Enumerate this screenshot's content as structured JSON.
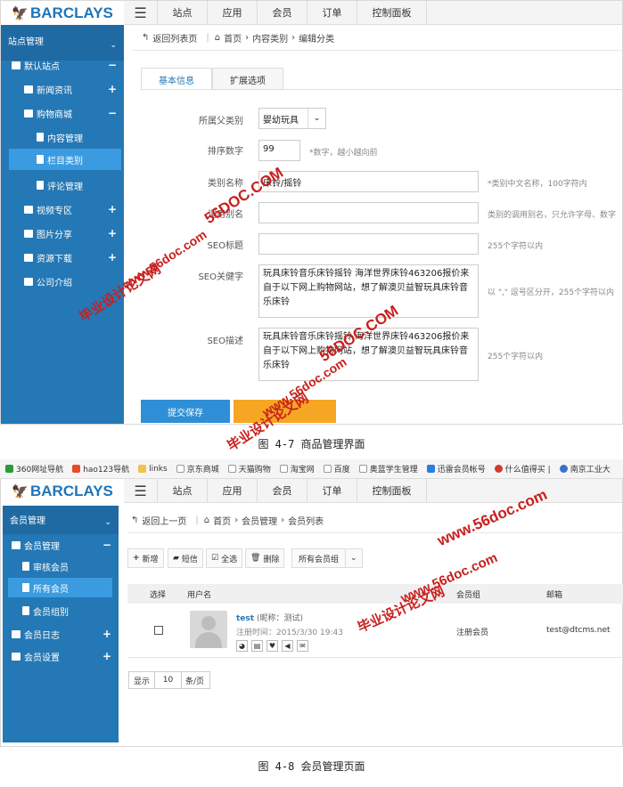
{
  "screen1": {
    "brand": "BARCLAYS",
    "top_tabs": [
      "站点",
      "应用",
      "会员",
      "订单",
      "控制面板"
    ],
    "sidebar": {
      "header": "站点管理",
      "items": [
        {
          "label": "默认站点",
          "toggle": "−"
        },
        {
          "label": "新闻资讯",
          "toggle": "+"
        },
        {
          "label": "购物商城",
          "toggle": "−"
        },
        {
          "label": "内容管理",
          "toggle": ""
        },
        {
          "label": "栏目类别",
          "toggle": ""
        },
        {
          "label": "评论管理",
          "toggle": ""
        },
        {
          "label": "视频专区",
          "toggle": "+"
        },
        {
          "label": "图片分享",
          "toggle": "+"
        },
        {
          "label": "资源下载",
          "toggle": "+"
        },
        {
          "label": "公司介绍",
          "toggle": ""
        }
      ]
    },
    "breadcrumb": {
      "back": "返回列表页",
      "home": "首页",
      "c1": "内容类别",
      "c2": "编辑分类"
    },
    "tabs": [
      "基本信息",
      "扩展选项"
    ],
    "form": {
      "parent_label": "所属父类别",
      "parent_value": "婴幼玩具",
      "sort_label": "排序数字",
      "sort_value": "99",
      "sort_hint": "*数字，越小越向前",
      "name_label": "类别名称",
      "name_value": "床铃/摇铃",
      "name_hint": "*类别中文名称，100字符内",
      "alias_label": "调用别名",
      "alias_value": "",
      "alias_hint": "类别的调用别名，只允许字母、数字",
      "seo_title_label": "SEO标题",
      "seo_title_value": "",
      "seo_title_hint": "255个字符以内",
      "seo_kw_label": "SEO关健字",
      "seo_kw_value": "玩具床铃音乐床铃摇铃 海洋世界床铃463206报价来自于以下网上购物网站，想了解澳贝益智玩具床铃音乐床铃",
      "seo_kw_hint": "以 \",\" 逗号区分开，255个字符以内",
      "seo_desc_label": "SEO描述",
      "seo_desc_value": "玩具床铃音乐床铃摇铃 海洋世界床铃463206报价来自于以下网上购物网站，想了解澳贝益智玩具床铃音乐床铃",
      "seo_desc_hint": "255个字符以内"
    },
    "submit": "提交保存",
    "caption": "图 4-7 商品管理界面"
  },
  "screen2": {
    "bookmarks": [
      "360网址导航",
      "hao123导航",
      "links",
      "京东商城",
      "天猫购物",
      "淘宝网",
      "百度",
      "奥蓝学生管理",
      "迅雷会员帐号",
      "什么值得买 |",
      "南京工业大"
    ],
    "brand": "BARCLAYS",
    "top_tabs": [
      "站点",
      "应用",
      "会员",
      "订单",
      "控制面板"
    ],
    "sidebar": {
      "header": "会员管理",
      "items": [
        {
          "label": "会员管理",
          "toggle": "−"
        },
        {
          "label": "审核会员",
          "toggle": ""
        },
        {
          "label": "所有会员",
          "toggle": ""
        },
        {
          "label": "会员组别",
          "toggle": ""
        },
        {
          "label": "会员日志",
          "toggle": "+"
        },
        {
          "label": "会员设置",
          "toggle": "+"
        }
      ]
    },
    "breadcrumb": {
      "back": "返回上一页",
      "home": "首页",
      "c1": "会员管理",
      "c2": "会员列表"
    },
    "toolbar": {
      "add": "新增",
      "sms": "短信",
      "all": "全选",
      "del": "删除",
      "group": "所有会员组"
    },
    "table": {
      "headers": [
        "选择",
        "用户名",
        "会员组",
        "邮箱"
      ],
      "rows": [
        {
          "username": "test",
          "nickname": "(昵称：测试)",
          "reg_time": "注册时间：2015/3/30 19:43",
          "group": "注册会员",
          "email": "test@dtcms.net"
        }
      ]
    },
    "pager": {
      "show": "显示",
      "size": "10",
      "unit": "条/页"
    },
    "caption": "图 4-8 会员管理页面"
  },
  "watermarks": {
    "site": "www.56doc.com",
    "cn": "毕业设计论文网",
    "site_upper": "56DOC.COM"
  }
}
